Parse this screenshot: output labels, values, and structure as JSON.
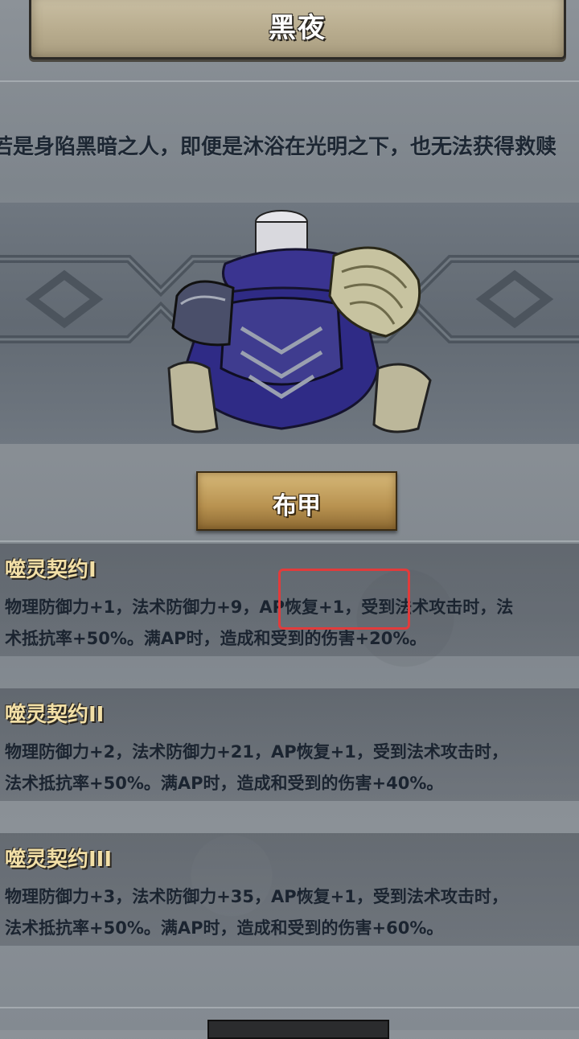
{
  "title": "黑夜",
  "quote": "若是身陷黑暗之人，即便是沐浴在光明之下，也无法获得救赎",
  "item_type": "布甲",
  "skills": [
    {
      "name": "噬灵契约I",
      "line1": "物理防御力+1，法术防御力+9，AP恢复+1，受到法术攻击时，法",
      "line2": "术抵抗率+50%。满AP时，造成和受到的伤害+20%。"
    },
    {
      "name": "噬灵契约II",
      "line1": "物理防御力+2，法术防御力+21，AP恢复+1，受到法术攻击时，",
      "line2": "法术抵抗率+50%。满AP时，造成和受到的伤害+40%。"
    },
    {
      "name": "噬灵契约III",
      "line1": "物理防御力+3，法术防御力+35，AP恢复+1，受到法术攻击时，",
      "line2": "法术抵抗率+50%。满AP时，造成和受到的伤害+60%。"
    }
  ],
  "colors": {
    "skill_title": "#f2dfa6",
    "highlight": "#e23b3b",
    "armor_purple": "#3b3a9a"
  },
  "icons": {
    "armor": "purple-cloth-armor-icon"
  }
}
